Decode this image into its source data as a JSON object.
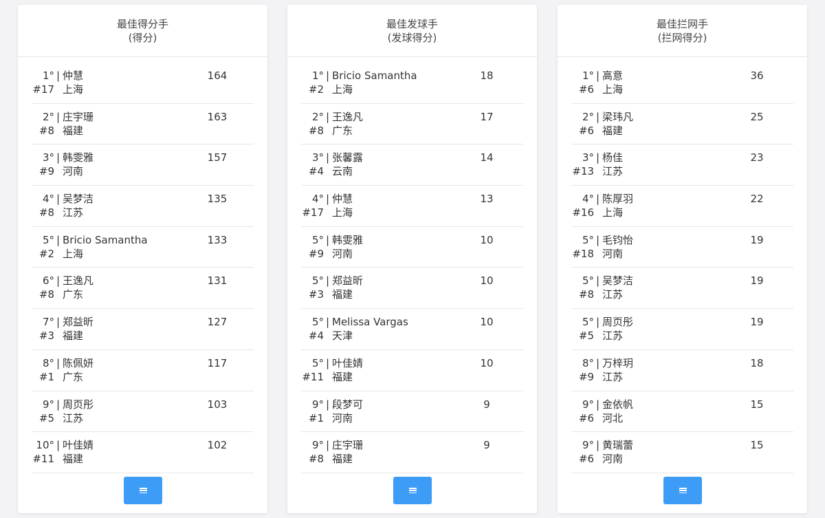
{
  "panels": [
    {
      "title": "最佳得分手",
      "subtitle": "(得分)",
      "rows": [
        {
          "rank": "1°",
          "name": "仲慧",
          "number": "#17",
          "team": "上海",
          "score": "164"
        },
        {
          "rank": "2°",
          "name": "庄宇珊",
          "number": "#8",
          "team": "福建",
          "score": "163"
        },
        {
          "rank": "3°",
          "name": "韩雯雅",
          "number": "#9",
          "team": "河南",
          "score": "157"
        },
        {
          "rank": "4°",
          "name": "吴梦洁",
          "number": "#8",
          "team": "江苏",
          "score": "135"
        },
        {
          "rank": "5°",
          "name": "Bricio Samantha",
          "number": "#2",
          "team": "上海",
          "score": "133"
        },
        {
          "rank": "6°",
          "name": "王逸凡",
          "number": "#8",
          "team": "广东",
          "score": "131"
        },
        {
          "rank": "7°",
          "name": "郑益昕",
          "number": "#3",
          "team": "福建",
          "score": "127"
        },
        {
          "rank": "8°",
          "name": "陈佩妍",
          "number": "#1",
          "team": "广东",
          "score": "117"
        },
        {
          "rank": "9°",
          "name": "周页彤",
          "number": "#5",
          "team": "江苏",
          "score": "103"
        },
        {
          "rank": "10°",
          "name": "叶佳婧",
          "number": "#11",
          "team": "福建",
          "score": "102"
        }
      ]
    },
    {
      "title": "最佳发球手",
      "subtitle": "(发球得分)",
      "rows": [
        {
          "rank": "1°",
          "name": "Bricio Samantha",
          "number": "#2",
          "team": "上海",
          "score": "18"
        },
        {
          "rank": "2°",
          "name": "王逸凡",
          "number": "#8",
          "team": "广东",
          "score": "17"
        },
        {
          "rank": "3°",
          "name": "张馨露",
          "number": "#4",
          "team": "云南",
          "score": "14"
        },
        {
          "rank": "4°",
          "name": "仲慧",
          "number": "#17",
          "team": "上海",
          "score": "13"
        },
        {
          "rank": "5°",
          "name": "韩雯雅",
          "number": "#9",
          "team": "河南",
          "score": "10"
        },
        {
          "rank": "5°",
          "name": "郑益昕",
          "number": "#3",
          "team": "福建",
          "score": "10"
        },
        {
          "rank": "5°",
          "name": "Melissa Vargas",
          "number": "#4",
          "team": "天津",
          "score": "10"
        },
        {
          "rank": "5°",
          "name": "叶佳婧",
          "number": "#11",
          "team": "福建",
          "score": "10"
        },
        {
          "rank": "9°",
          "name": "段梦可",
          "number": "#1",
          "team": "河南",
          "score": "9"
        },
        {
          "rank": "9°",
          "name": "庄宇珊",
          "number": "#8",
          "team": "福建",
          "score": "9"
        }
      ]
    },
    {
      "title": "最佳拦网手",
      "subtitle": "(拦网得分)",
      "rows": [
        {
          "rank": "1°",
          "name": "高意",
          "number": "#6",
          "team": "上海",
          "score": "36"
        },
        {
          "rank": "2°",
          "name": "梁玮凡",
          "number": "#6",
          "team": "福建",
          "score": "25"
        },
        {
          "rank": "3°",
          "name": "杨佳",
          "number": "#13",
          "team": "江苏",
          "score": "23"
        },
        {
          "rank": "4°",
          "name": "陈厚羽",
          "number": "#16",
          "team": "上海",
          "score": "22"
        },
        {
          "rank": "5°",
          "name": "毛钧怡",
          "number": "#18",
          "team": "河南",
          "score": "19"
        },
        {
          "rank": "5°",
          "name": "吴梦洁",
          "number": "#8",
          "team": "江苏",
          "score": "19"
        },
        {
          "rank": "5°",
          "name": "周页彤",
          "number": "#5",
          "team": "江苏",
          "score": "19"
        },
        {
          "rank": "8°",
          "name": "万梓玥",
          "number": "#9",
          "team": "江苏",
          "score": "18"
        },
        {
          "rank": "9°",
          "name": "金依帆",
          "number": "#6",
          "team": "河北",
          "score": "15"
        },
        {
          "rank": "9°",
          "name": "黄瑞蕾",
          "number": "#6",
          "team": "河南",
          "score": "15"
        }
      ]
    }
  ],
  "separator": "|",
  "menu_button_icon": "menu-icon",
  "colors": {
    "accent": "#3d9cf5",
    "background": "#f3f3f5",
    "card": "#ffffff",
    "divider": "#e6e6e6"
  }
}
